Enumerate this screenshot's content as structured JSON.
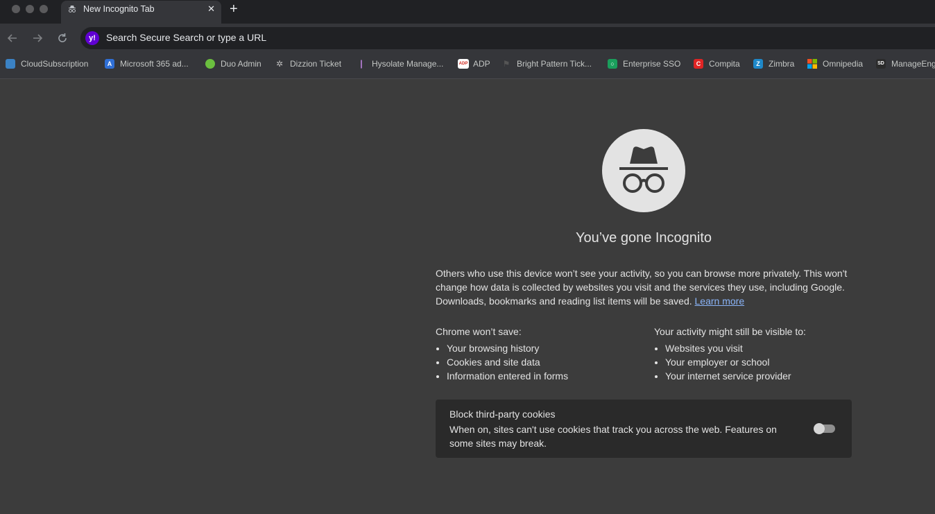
{
  "tab": {
    "title": "New Incognito Tab",
    "close_glyph": "✕",
    "new_tab_glyph": "+"
  },
  "toolbar": {
    "omnibox_placeholder": "Search Secure Search or type a URL",
    "search_engine_badge": "y!"
  },
  "bookmarks": [
    {
      "label": "CloudSubscription",
      "icon": "grid-icon",
      "color": "#3b82c4",
      "glyph": ""
    },
    {
      "label": "Microsoft 365 ad...",
      "icon": "admin-icon",
      "color": "#2f6fd6",
      "glyph": "A"
    },
    {
      "label": "Duo Admin",
      "icon": "duo-icon",
      "color": "#6bbf3f",
      "glyph": ""
    },
    {
      "label": "Dizzion Ticket",
      "icon": "dizzion-icon",
      "color": "#555555",
      "glyph": "✲"
    },
    {
      "label": "Hysolate Manage...",
      "icon": "hysolate-icon",
      "color": "#8a4fa8",
      "glyph": "|"
    },
    {
      "label": "ADP",
      "icon": "adp-icon",
      "color": "#d0271d",
      "glyph": "ADP"
    },
    {
      "label": "Bright Pattern Tick...",
      "icon": "flag-icon",
      "color": "#4a4a4a",
      "glyph": "⚑"
    },
    {
      "label": "Enterprise SSO",
      "icon": "sso-icon",
      "color": "#1a9e5c",
      "glyph": "○"
    },
    {
      "label": "Compita",
      "icon": "compita-icon",
      "color": "#e02424",
      "glyph": "C"
    },
    {
      "label": "Zimbra",
      "icon": "zimbra-icon",
      "color": "#1e88c9",
      "glyph": "Z"
    },
    {
      "label": "Omnipedia",
      "icon": "windows-icon",
      "color": "#f25022",
      "glyph": ""
    },
    {
      "label": "ManageEngine",
      "icon": "sd-icon",
      "color": "#2b2b2b",
      "glyph": "SD"
    }
  ],
  "incognito": {
    "headline": "You’ve gone Incognito",
    "intro": "Others who use this device won’t see your activity, so you can browse more privately. This won't change how data is collected by websites you visit and the services they use, including Google. Downloads, bookmarks and reading list items will be saved.",
    "learn_more": "Learn more",
    "wont_save_title": "Chrome won’t save:",
    "wont_save_items": [
      "Your browsing history",
      "Cookies and site data",
      "Information entered in forms"
    ],
    "visible_title_prefix": "Your activity ",
    "visible_title_emphasis": "might",
    "visible_title_suffix": " still be visible to:",
    "visible_items": [
      "Websites you visit",
      "Your employer or school",
      "Your internet service provider"
    ],
    "cookies_title": "Block third-party cookies",
    "cookies_desc": "When on, sites can't use cookies that track you across the web. Features on some sites may break.",
    "cookies_toggle_on": false
  },
  "colors": {
    "page_bg": "#3c3c3c",
    "link": "#8ab4f8",
    "card_bg": "#2a2a2a"
  }
}
